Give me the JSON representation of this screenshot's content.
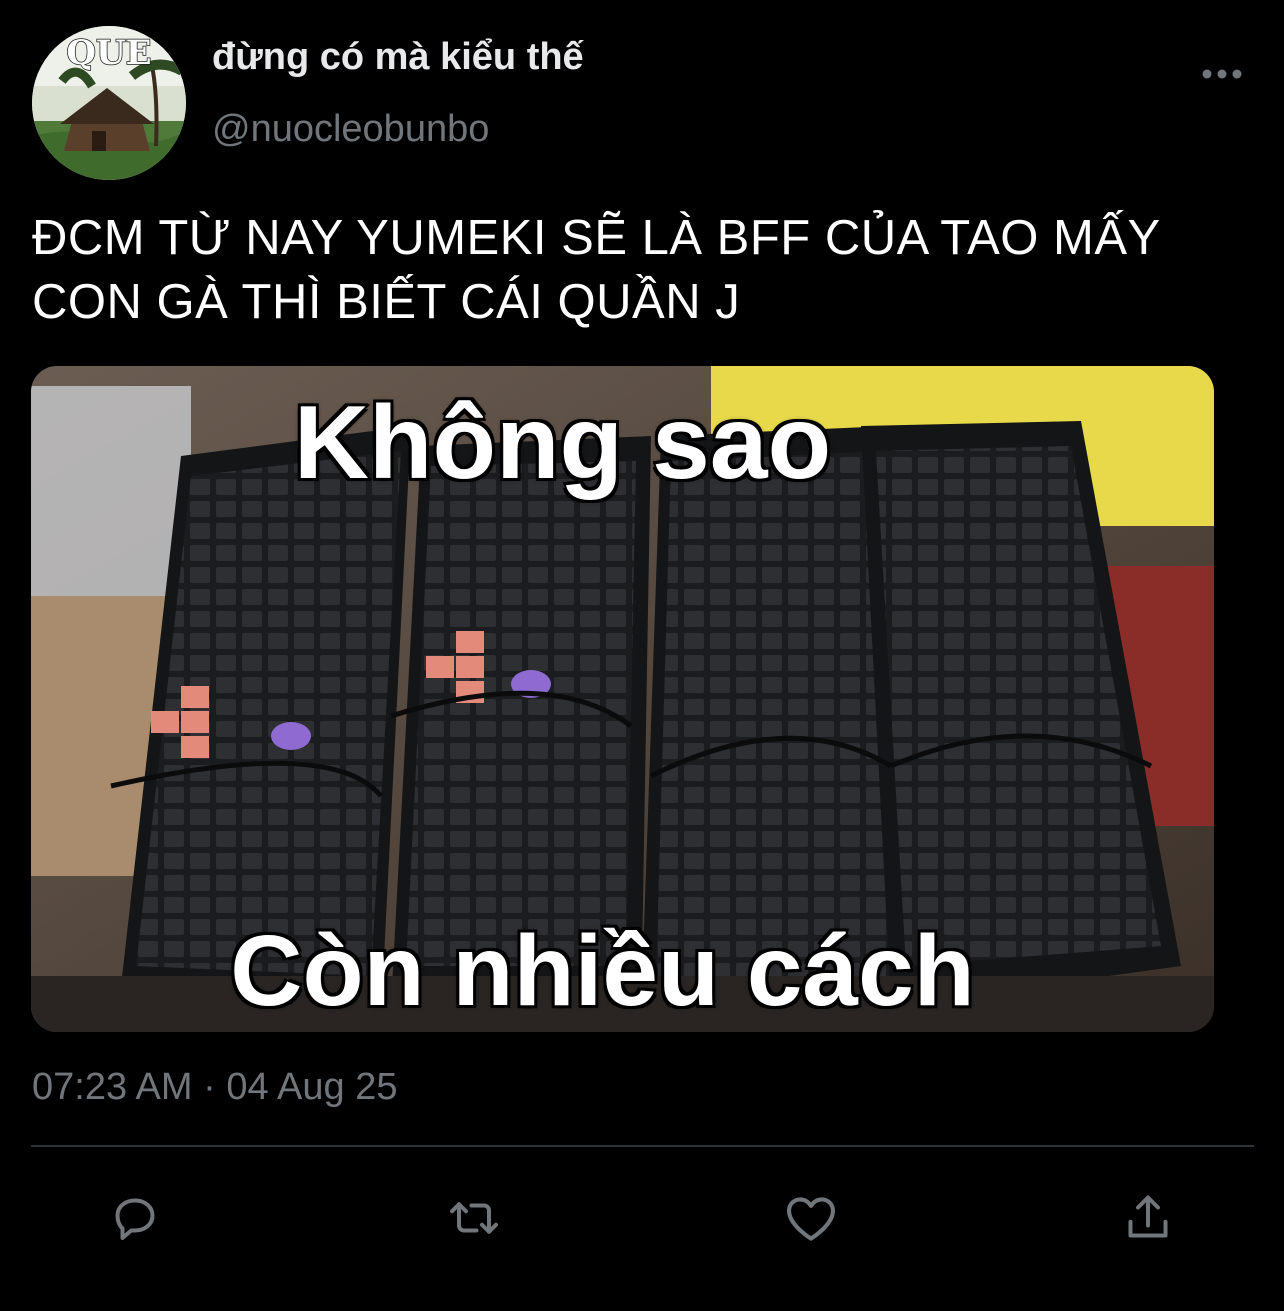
{
  "user": {
    "display_name": "đừng có mà kiểu thế",
    "handle": "@nuocleobunbo",
    "avatar_text": "QUE"
  },
  "tweet": {
    "text": "ĐCM TỪ NAY YUMEKI SẼ LÀ BFF CỦA TAO MẤY CON GÀ THÌ BIẾT CÁI QUẦN J",
    "timestamp": "07:23 AM · 04 Aug 25"
  },
  "media": {
    "caption_top": "Không sao",
    "caption_bottom": "Còn nhiều cách"
  },
  "actions": {
    "reply_icon": "reply-icon",
    "retweet_icon": "retweet-icon",
    "like_icon": "heart-icon",
    "share_icon": "share-icon"
  },
  "colors": {
    "background": "#000000",
    "primary_text": "#e7e9ea",
    "secondary_text": "#71767b",
    "icon": "#71767b",
    "divider": "#2f3336"
  }
}
